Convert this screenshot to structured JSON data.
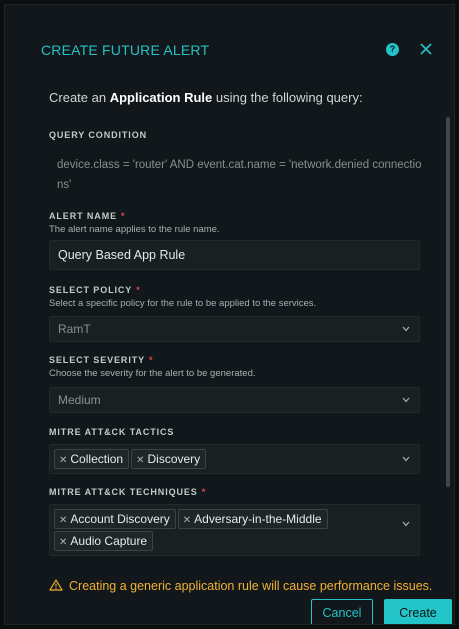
{
  "dialog": {
    "title": "CREATE FUTURE ALERT",
    "help_icon": "question-circle-icon",
    "close_icon": "close-icon"
  },
  "intro": {
    "prefix": "Create an ",
    "bold": "Application Rule",
    "suffix": " using the following query:"
  },
  "query": {
    "label": "QUERY CONDITION",
    "text": "device.class = 'router' AND event.cat.name = 'network.denied connections'"
  },
  "alert_name": {
    "label": "ALERT NAME",
    "required": "*",
    "helper": "The alert name applies to the rule name.",
    "value": "Query Based App Rule"
  },
  "policy": {
    "label": "SELECT POLICY",
    "required": "*",
    "helper": "Select a specific policy for the rule to be applied to the services.",
    "value": "RamT"
  },
  "severity": {
    "label": "SELECT SEVERITY",
    "required": "*",
    "helper": "Choose the severity for the alert to be generated.",
    "value": "Medium"
  },
  "tactics": {
    "label": "MITRE ATT&CK TACTICS",
    "tags": [
      "Collection",
      "Discovery"
    ]
  },
  "techniques": {
    "label": "MITRE ATT&CK TECHNIQUES",
    "required": "*",
    "tags": [
      "Account Discovery",
      "Adversary-in-the-Middle",
      "Audio Capture"
    ]
  },
  "warning": {
    "icon": "warning-triangle-icon",
    "text": "Creating a generic application rule will cause performance issues."
  },
  "buttons": {
    "cancel": "Cancel",
    "create": "Create"
  },
  "colors": {
    "accent": "#23c4c8",
    "background": "#11171a",
    "required": "#e34850",
    "warning": "#f2b134"
  }
}
